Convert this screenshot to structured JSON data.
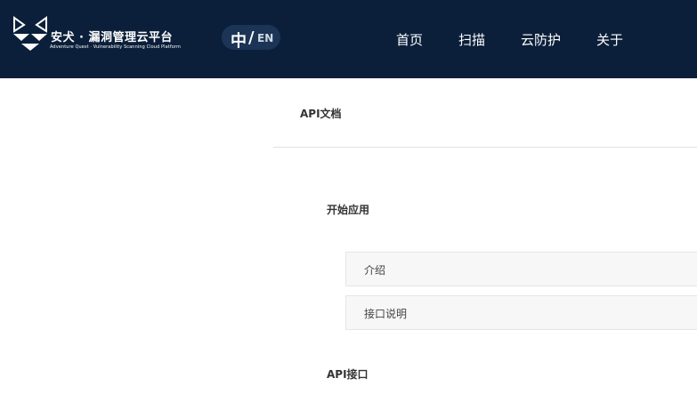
{
  "header": {
    "brand_cn": "安犬 · 漏洞管理云平台",
    "brand_en": "Adventure Quest · Vulnerability Scanning Cloud Platform",
    "logo_icon": "fox-logo-icon",
    "lang": {
      "zh": "中",
      "slash": "/",
      "en": "EN"
    },
    "nav": [
      {
        "label": "首页"
      },
      {
        "label": "扫描"
      },
      {
        "label": "云防护"
      },
      {
        "label": "关于"
      }
    ]
  },
  "main": {
    "title": "API文档",
    "sections": [
      {
        "heading": "开始应用",
        "items": [
          {
            "label": "介绍"
          },
          {
            "label": "接口说明"
          }
        ]
      },
      {
        "heading": "API接口",
        "items": []
      }
    ]
  },
  "colors": {
    "header_bg": "#0b1f3a",
    "lang_pill_bg": "#1c3556",
    "item_bg": "#f7f7f7",
    "divider": "#e2e2e2"
  }
}
